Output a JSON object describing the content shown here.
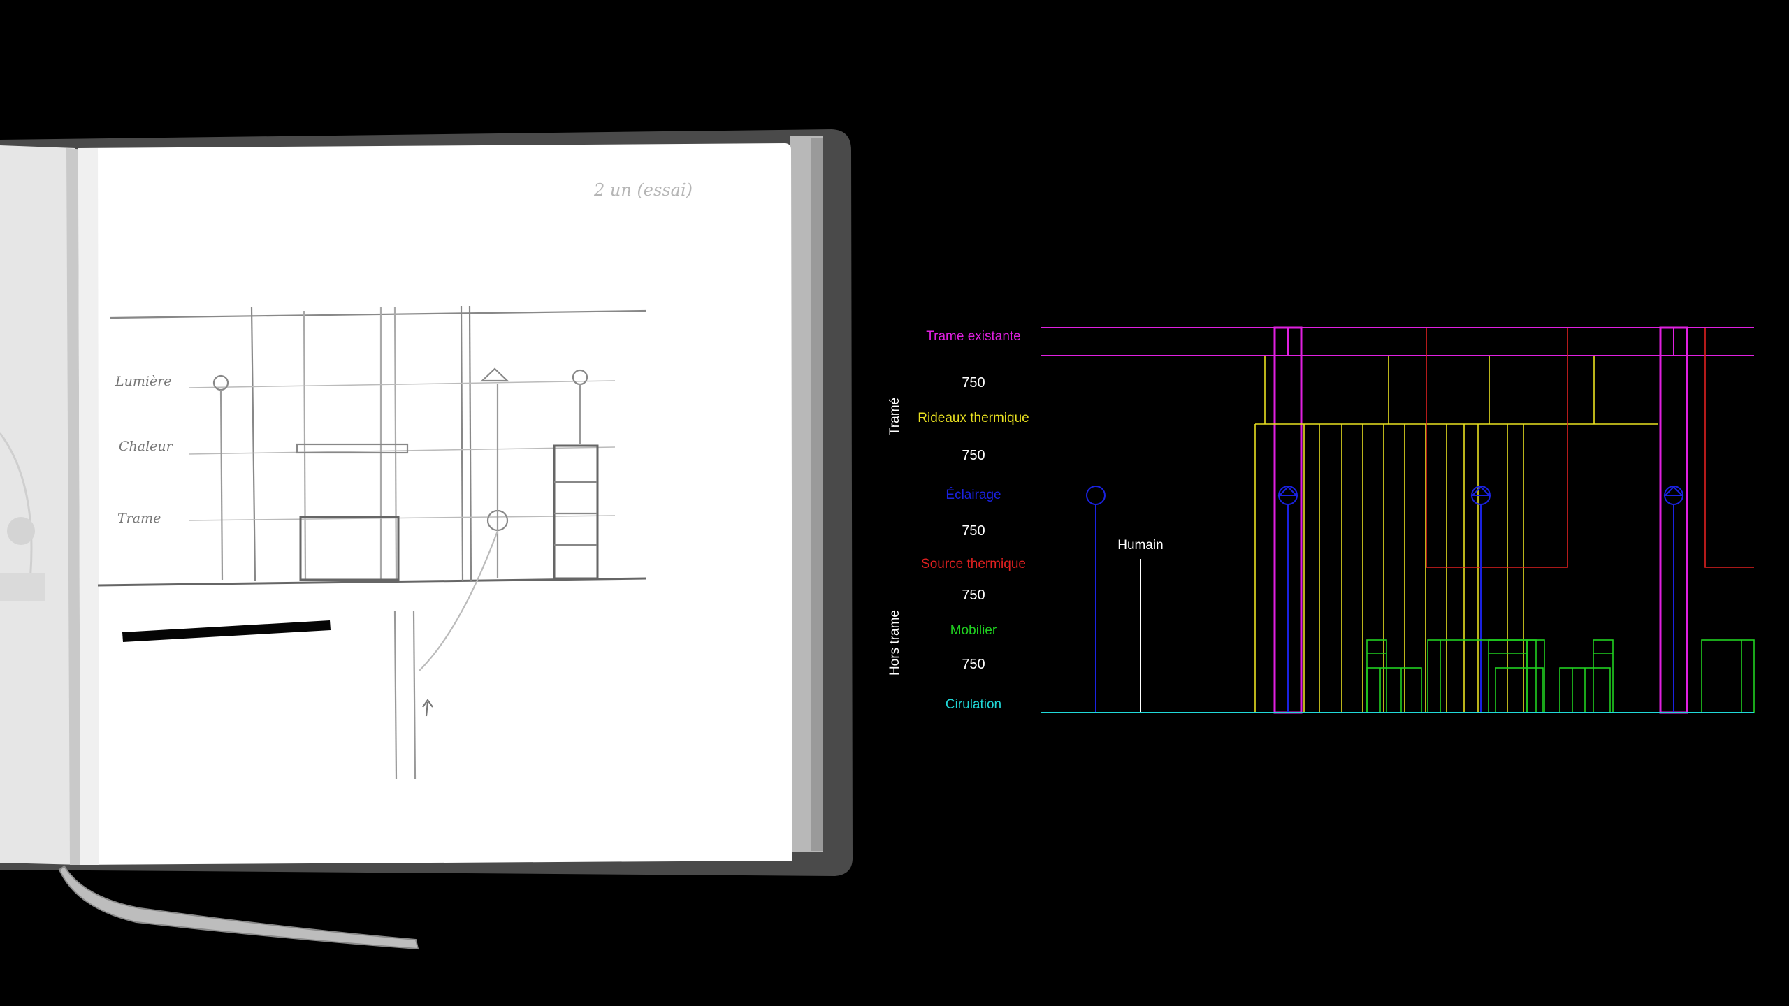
{
  "diagram": {
    "group_labels": {
      "trame": "Tramé",
      "hors_trame": "Hors trame"
    },
    "layers": [
      {
        "key": "trame_existante",
        "label": "Trame existante",
        "color": "#e020e0"
      },
      {
        "key": "rideaux",
        "label": "Rideaux thermique",
        "color": "#e8e020"
      },
      {
        "key": "eclairage",
        "label": "Éclairage",
        "color": "#1a22e0"
      },
      {
        "key": "source",
        "label": "Source thermique",
        "color": "#e02020"
      },
      {
        "key": "mobilier",
        "label": "Mobilier",
        "color": "#20d020"
      },
      {
        "key": "circulation",
        "label": "Cirulation",
        "color": "#20d8d8"
      }
    ],
    "dimensions": [
      "750",
      "750",
      "750",
      "750",
      "750"
    ],
    "human_label": "Humain"
  },
  "sketch": {
    "handwritten_labels": [
      "Lumière",
      "Chaleur",
      "Trame"
    ],
    "header_scribble": "2 un (essai)"
  }
}
